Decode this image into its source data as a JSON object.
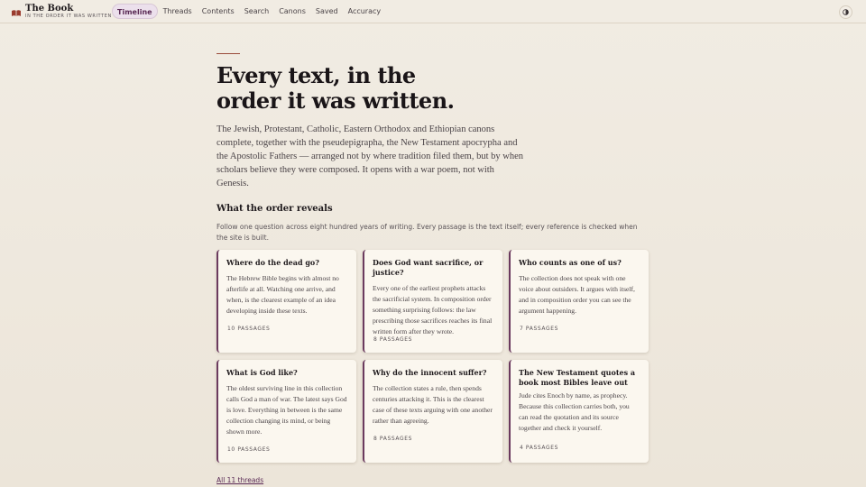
{
  "brand": {
    "title": "The Book",
    "subtitle": "IN THE ORDER IT WAS WRITTEN"
  },
  "nav": {
    "items": [
      {
        "label": "Timeline",
        "active": true
      },
      {
        "label": "Threads"
      },
      {
        "label": "Contents"
      },
      {
        "label": "Search"
      },
      {
        "label": "Canons"
      },
      {
        "label": "Saved"
      },
      {
        "label": "Accuracy"
      }
    ],
    "theme_icon": "◐"
  },
  "hero": {
    "title_line1": "Every text, in the",
    "title_line2": "order it was written.",
    "body": "The Jewish, Protestant, Catholic, Eastern Orthodox and Ethiopian canons complete, together with the pseudepigrapha, the New Testament apocrypha and the Apostolic Fathers — arranged not by where tradition filed them, but by when scholars believe they were composed. It opens with a war poem, not with Genesis."
  },
  "section": {
    "title": "What the order reveals",
    "desc": "Follow one question across eight hundred years of writing. Every passage is the text itself; every reference is checked when the site is built."
  },
  "cards": [
    {
      "title": "Where do the dead go?",
      "body": "The Hebrew Bible begins with almost no afterlife at all. Watching one arrive, and when, is the clearest example of an idea developing inside these texts.",
      "count": "10 PASSAGES"
    },
    {
      "title": "Does God want sacrifice, or justice?",
      "body": "Every one of the earliest prophets attacks the sacrificial system. In composition order something surprising follows: the law prescribing those sacrifices reaches its final written form after they wrote.",
      "count": "8 PASSAGES"
    },
    {
      "title": "Who counts as one of us?",
      "body": "The collection does not speak with one voice about outsiders. It argues with itself, and in composition order you can see the argument happening.",
      "count": "7 PASSAGES"
    },
    {
      "title": "What is God like?",
      "body": "The oldest surviving line in this collection calls God a man of war. The latest says God is love. Everything in between is the same collection changing its mind, or being shown more.",
      "count": "10 PASSAGES"
    },
    {
      "title": "Why do the innocent suffer?",
      "body": "The collection states a rule, then spends centuries attacking it. This is the clearest case of these texts arguing with one another rather than agreeing.",
      "count": "8 PASSAGES"
    },
    {
      "title": "The New Testament quotes a book most Bibles leave out",
      "body": "Jude cites Enoch by name, as prophecy. Because this collection carries both, you can read the quotation and its source together and check it yourself.",
      "count": "4 PASSAGES"
    }
  ],
  "all_link": "All 11 threads",
  "colors": {
    "accent": "#6b3a5e",
    "rule": "#9a4b3a",
    "background": "#efe9df"
  }
}
